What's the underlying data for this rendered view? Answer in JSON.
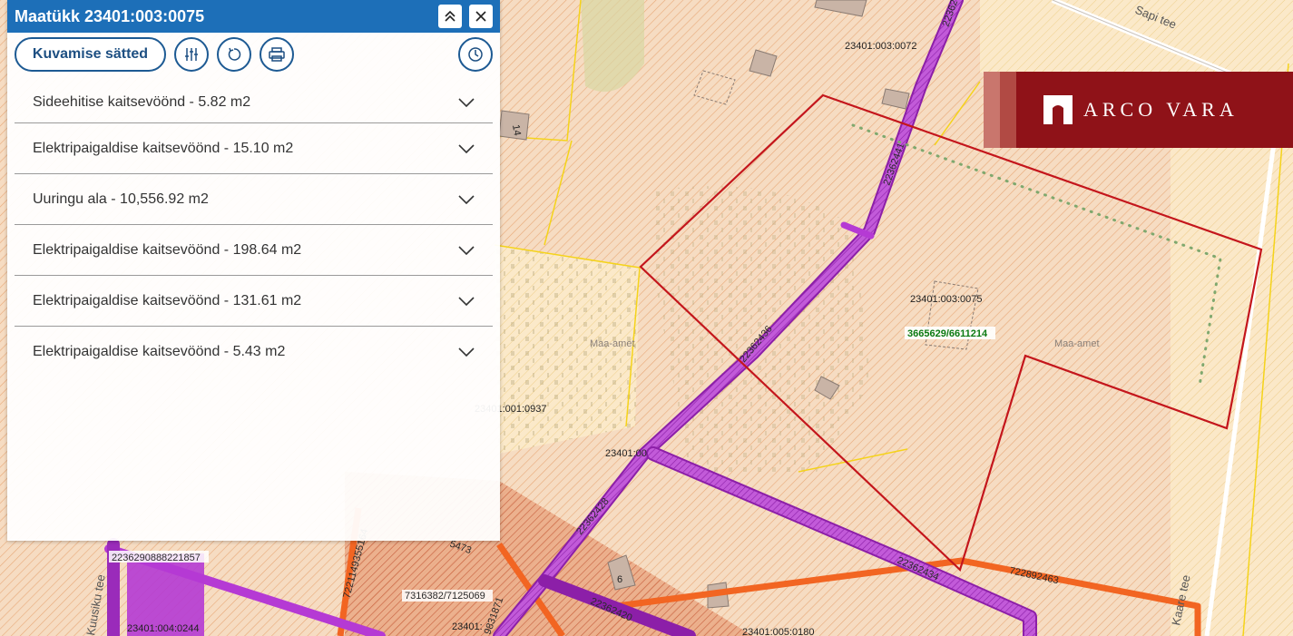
{
  "panel": {
    "title": "Maatükk 23401:003:0075",
    "settings_label": "Kuvamise sätted",
    "items": [
      {
        "label": "Sideehitise kaitsevöönd - 5.82 m2"
      },
      {
        "label": "Elektripaigaldise kaitsevöönd - 15.10 m2"
      },
      {
        "label": "Uuringu ala - 10,556.92 m2"
      },
      {
        "label": "Elektripaigaldise kaitsevöönd - 198.64 m2"
      },
      {
        "label": "Elektripaigaldise kaitsevöönd - 131.61 m2"
      },
      {
        "label": "Elektripaigaldise kaitsevöönd - 5.43 m2"
      }
    ]
  },
  "brand": {
    "name": "ARCO VARA"
  },
  "map": {
    "parcel_labels": [
      "23401:003:0072",
      "23401:003:0075",
      "23401:001:0937",
      "23401:00",
      "23401:005:0180",
      "23401:004:0244",
      "23401:"
    ],
    "coordinates": "3665629/6611214",
    "owner_labels": [
      "Maa-amet",
      "Maa-amet"
    ],
    "road_labels": [
      "Sapi tee",
      "Kaare tee",
      "Kuusiku tee"
    ],
    "pipe_labels": [
      "22362441",
      "22362436",
      "22362428",
      "22362434",
      "22362420",
      "22362",
      "722892463",
      "7316382/7125069",
      "2236290888221857",
      "7221149355164",
      "5473",
      "9831871"
    ],
    "misc_labels": [
      "14",
      "6"
    ]
  },
  "colors": {
    "header": "#1d6fb8",
    "parcel_outline": "#c4161c",
    "pipe": "#b53ad4",
    "power_line": "#f26522"
  }
}
